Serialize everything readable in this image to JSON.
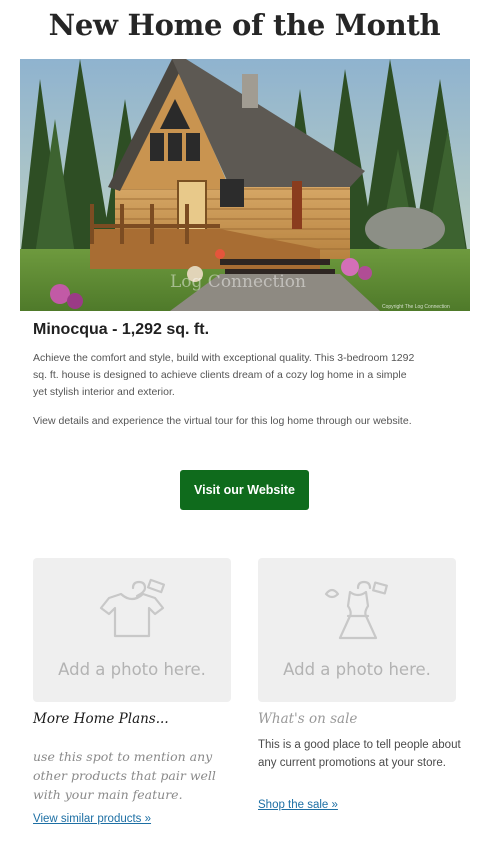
{
  "header": {
    "title": "New Home of the Month"
  },
  "feature": {
    "image_watermark": "Log Connection",
    "image_copyright": "Copyright The Log Connection",
    "name": "Minocqua - 1,292 sq. ft.",
    "description_1": "Achieve the comfort and style, build with exceptional quality. This 3-bedroom 1292 sq. ft. house is designed to achieve clients dream of a cozy log home in a simple yet stylish interior and exterior.",
    "description_2": "View details and experience the virtual tour for this log home through our website.",
    "cta_label": "Visit our Website"
  },
  "columns": {
    "left": {
      "placeholder_icon": "tshirt-icon",
      "placeholder_text": "Add a photo here.",
      "title": "More Home Plans...",
      "body": "use this spot to mention any other products that pair well with your main feature.",
      "link": "View similar products »"
    },
    "right": {
      "placeholder_icon": "dress-icon",
      "placeholder_text": "Add a photo here.",
      "title": "What's on sale",
      "body": "This is a good place to tell people about any current promotions at your store.",
      "link": "Shop the sale »"
    }
  },
  "colors": {
    "cta_bg": "#0f6b1c",
    "link": "#1d6fa4",
    "placeholder_bg": "#efefef"
  }
}
